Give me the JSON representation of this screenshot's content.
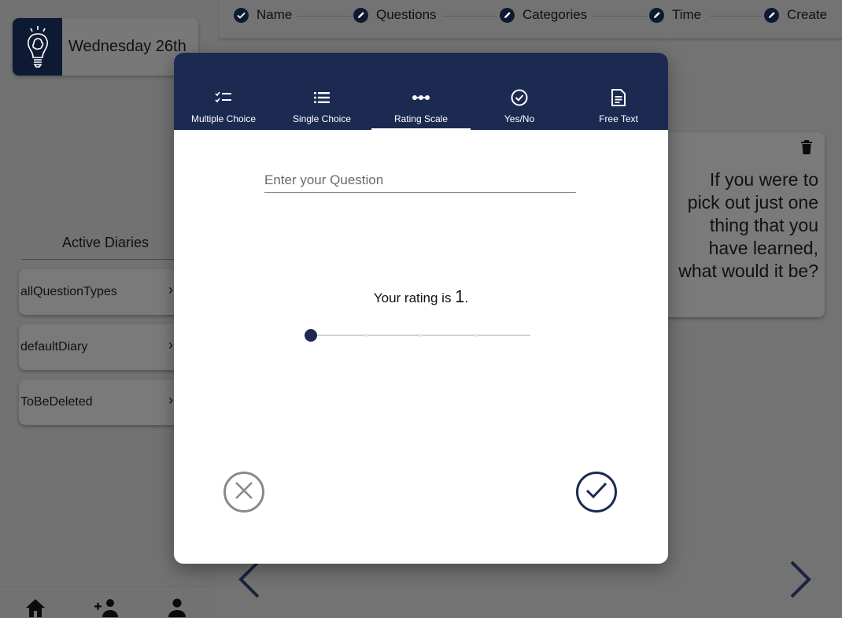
{
  "sidebar": {
    "date": "Wednesday 26th",
    "diaries_title": "Active Diaries",
    "diaries": [
      {
        "name": "allQuestionTypes"
      },
      {
        "name": "defaultDiary"
      },
      {
        "name": "ToBeDeleted"
      }
    ],
    "bottom_nav_icons": [
      "home-icon",
      "add-person-icon",
      "person-icon"
    ]
  },
  "stepper": {
    "steps": [
      {
        "label": "Name",
        "state": "complete"
      },
      {
        "label": "Questions",
        "state": "editing"
      },
      {
        "label": "Categories",
        "state": "editing"
      },
      {
        "label": "Time",
        "state": "editing"
      },
      {
        "label": "Create",
        "state": "editing"
      }
    ]
  },
  "question_card": {
    "lines": [
      "If you were to",
      "pick out just one",
      "thing that you",
      "have learned,",
      "what would it be?"
    ]
  },
  "modal": {
    "tabs": [
      {
        "label": "Multiple Choice",
        "icon": "checklist-icon"
      },
      {
        "label": "Single Choice",
        "icon": "list-icon"
      },
      {
        "label": "Rating Scale",
        "icon": "dots-icon"
      },
      {
        "label": "Yes/No",
        "icon": "check-circle-icon"
      },
      {
        "label": "Free Text",
        "icon": "document-icon"
      }
    ],
    "active_tab": "Rating Scale",
    "question_placeholder": "Enter your Question",
    "question_value": "",
    "rating_prefix": "Your rating is ",
    "rating_value": "1",
    "rating_suffix": ".",
    "slider": {
      "min": 1,
      "max": 5,
      "value": 1
    }
  },
  "colors": {
    "navy": "#1c2a52",
    "overlay": "#737373",
    "cancel_gray": "#8a8a86"
  }
}
